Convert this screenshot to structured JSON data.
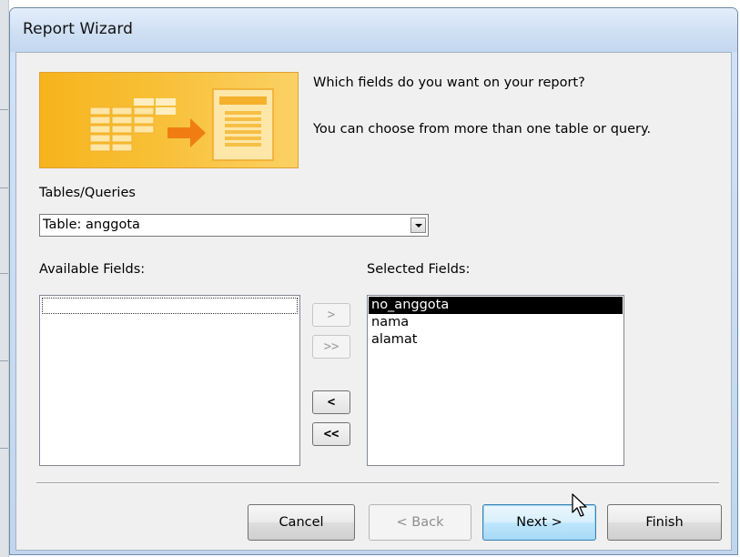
{
  "window": {
    "title": "Report Wizard"
  },
  "banner": {
    "icon": "report-wizard-illustration"
  },
  "prompt": {
    "question": "Which fields do you want on your report?",
    "hint": "You can choose from more than one table or query."
  },
  "tables_queries": {
    "label": "Tables/Queries",
    "selected": "Table: anggota"
  },
  "available_fields": {
    "label": "Available Fields:",
    "items": []
  },
  "selected_fields": {
    "label": "Selected Fields:",
    "items": [
      "no_anggota",
      "nama",
      "alamat"
    ],
    "highlighted": "no_anggota"
  },
  "move_buttons": {
    "add_one": ">",
    "add_all": ">>",
    "remove_one": "<",
    "remove_all": "<<"
  },
  "footer": {
    "cancel": "Cancel",
    "back": "< Back",
    "next": "Next >",
    "finish": "Finish"
  },
  "colors": {
    "banner_orange": "#f6b41c",
    "selection": "#000000",
    "focus_button": "#bee6fd"
  }
}
